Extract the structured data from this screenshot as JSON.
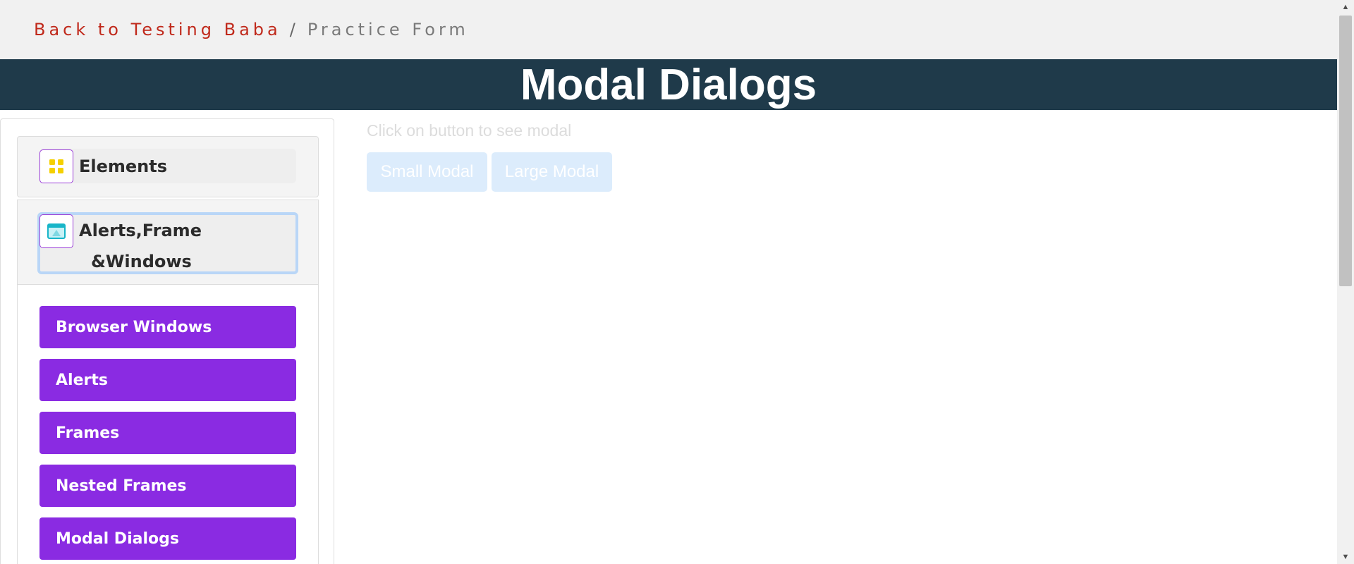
{
  "breadcrumb": {
    "back_label": "Back to Testing Baba",
    "separator": "/",
    "current_label": "Practice Form"
  },
  "header": {
    "title": "Modal Dialogs"
  },
  "sidebar": {
    "groups": [
      {
        "label": "Elements",
        "icon": "grid-icon"
      },
      {
        "label_line1": "Alerts,Frame",
        "label_line2": "&Windows",
        "icon": "browser-window-icon"
      }
    ],
    "items": [
      {
        "label": "Browser Windows"
      },
      {
        "label": "Alerts"
      },
      {
        "label": "Frames"
      },
      {
        "label": "Nested Frames"
      },
      {
        "label": "Modal Dialogs"
      }
    ]
  },
  "main": {
    "hint": "Click on button to see modal",
    "small_button": "Small Modal",
    "large_button": "Large Modal"
  },
  "colors": {
    "breadcrumb_link": "#c0291b",
    "header_bg": "#1f3a4a",
    "menu_button": "#8a2be2",
    "modal_button": "#dcecfc"
  }
}
